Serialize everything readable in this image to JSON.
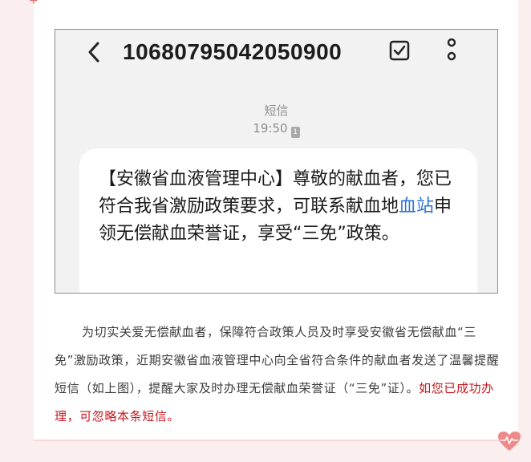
{
  "phone": {
    "sender_number": "10680795042050900",
    "message_type": "短信",
    "time": "19:50",
    "sim_label": "1",
    "message": {
      "part1": "【安徽省血液管理中心】尊敬的献血者，您已符合我省激励政策要求，可联系献血地",
      "link": "血站",
      "part2": "申领无偿献血荣誉证，享受“三免”政策。"
    }
  },
  "article": {
    "body": "为切实关爱无偿献血者，保障符合政策人员及时享受安徽省无偿献血“三免”激励政策，近期安徽省血液管理中心向全省符合条件的献血者发送了温馨提醒短信（如上图），提醒大家及时办理无偿献血荣誉证（“三免”证）。",
    "highlight": "如您已成功办理，可忽略本条短信。"
  },
  "icons": {
    "back": "chevron-left-icon",
    "select": "checkbox-icon",
    "more": "more-vertical-icon",
    "heart": "heart-ecg-icon",
    "plus": "plus-icon"
  },
  "colors": {
    "page_background": "#fbeeee",
    "link": "#2c74d4",
    "highlight": "#c8161d",
    "heart": "#ee8a8a"
  }
}
